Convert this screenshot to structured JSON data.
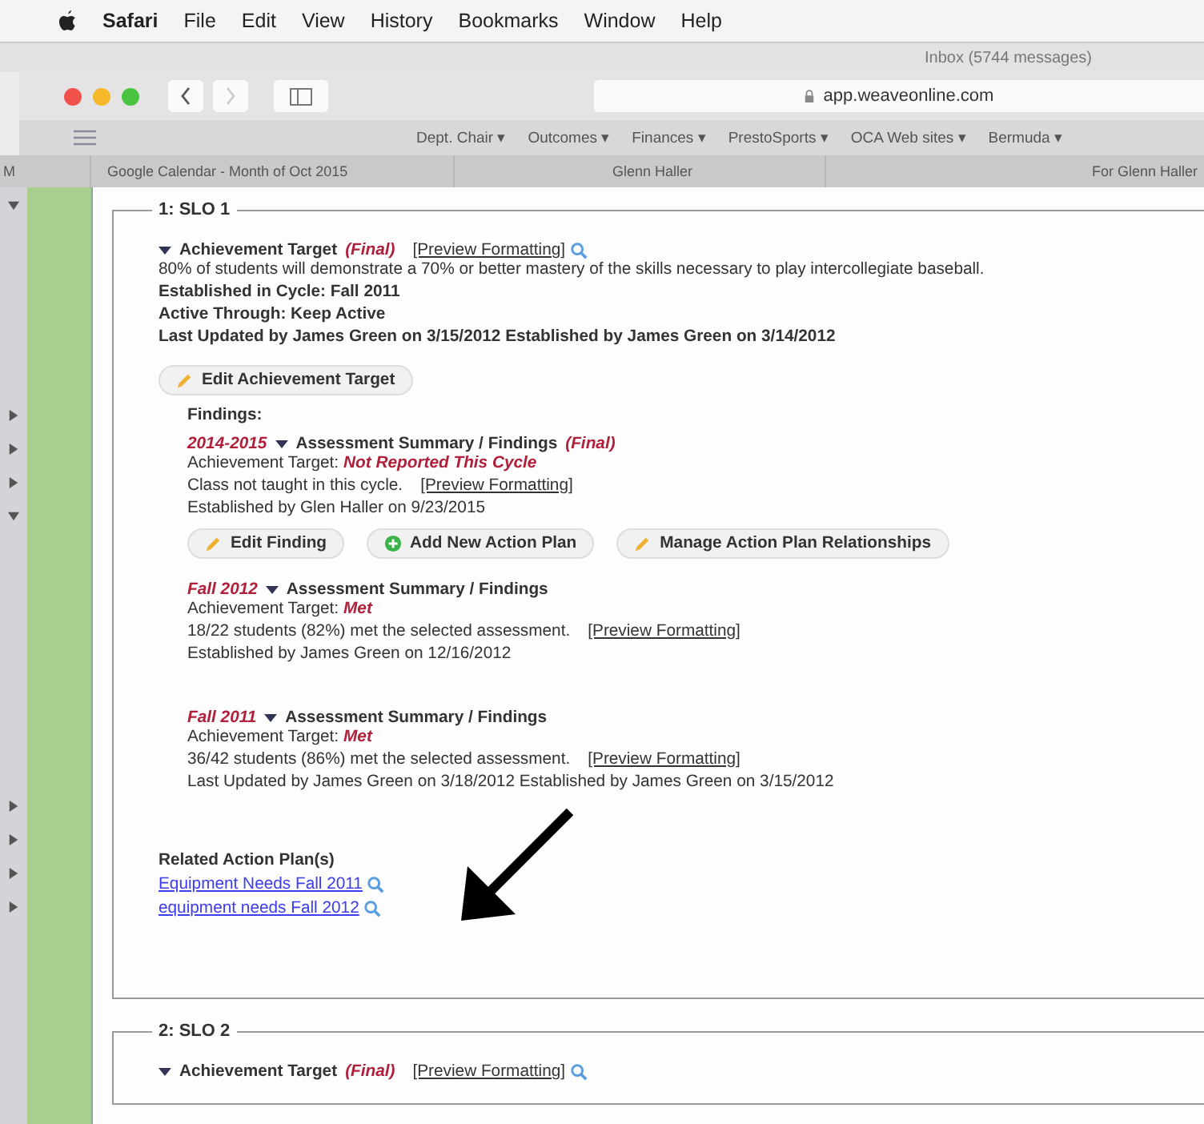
{
  "menu_bar": {
    "app": "Safari",
    "items": [
      "File",
      "Edit",
      "View",
      "History",
      "Bookmarks",
      "Window",
      "Help"
    ]
  },
  "background_window": {
    "title": "Inbox (5744 messages)"
  },
  "toolbar": {
    "address": "app.weaveonline.com"
  },
  "bookmarks": [
    "Dept. Chair ▾",
    "Outcomes ▾",
    "Finances ▾",
    "PrestoSports ▾",
    "OCA Web sites ▾",
    "Bermuda ▾"
  ],
  "tabs": [
    {
      "label": "Google Calendar - Month of Oct 2015",
      "selected": false
    },
    {
      "label": "Glenn Haller",
      "selected": false
    },
    {
      "label": "For Glenn Haller",
      "selected": false
    }
  ],
  "sidebar": {
    "label": "M",
    "toggles": [
      {
        "expanded": true
      },
      {
        "expanded": false
      },
      {
        "expanded": false
      },
      {
        "expanded": false
      },
      {
        "expanded": true
      },
      {
        "expanded": false
      },
      {
        "expanded": false
      },
      {
        "expanded": false
      },
      {
        "expanded": false
      }
    ]
  },
  "sections": [
    {
      "legend": "1: SLO 1",
      "target": {
        "title": "Achievement Target",
        "status": "(Final)",
        "preview": "[Preview Formatting]",
        "text": "80% of students will demonstrate a 70% or better mastery of the skills necessary to play intercollegiate baseball.",
        "details": [
          "Established in Cycle: Fall 2011",
          "Active Through: Keep Active",
          "Last Updated by James Green on 3/15/2012 Established by James Green on 3/14/2012"
        ],
        "button": "Edit Achievement Target"
      },
      "findings_label": "Findings:",
      "findings": [
        {
          "period": "2014-2015",
          "title": "Assessment Summary / Findings",
          "status": "(Final)",
          "target_label": "Achievement Target:",
          "target_value": "Not Reported This Cycle",
          "description": "Class not taught in this cycle.",
          "preview": "[Preview Formatting]",
          "established": "Established by Glen Haller on 9/23/2015",
          "buttons": [
            {
              "kind": "edit",
              "label": "Edit Finding"
            },
            {
              "kind": "add",
              "label": "Add New Action Plan"
            },
            {
              "kind": "edit",
              "label": "Manage Action Plan Relationships"
            }
          ]
        },
        {
          "period": "Fall 2012",
          "title": "Assessment Summary / Findings",
          "target_label": "Achievement Target:",
          "target_value": "Met",
          "description": "18/22 students (82%) met the selected assessment.",
          "preview": "[Preview Formatting]",
          "established": "Established by James Green on 12/16/2012"
        },
        {
          "period": "Fall 2011",
          "title": "Assessment Summary / Findings",
          "target_label": "Achievement Target:",
          "target_value": "Met",
          "description": "36/42 students (86%) met the selected assessment.",
          "preview": "[Preview Formatting]",
          "established": "Last Updated by James Green on 3/18/2012 Established by James Green on 3/15/2012"
        }
      ],
      "related_label": "Related Action Plan(s)",
      "related": [
        {
          "label": "Equipment Needs  Fall 2011"
        },
        {
          "label": "equipment needs  Fall 2012"
        }
      ]
    },
    {
      "legend": "2: SLO 2",
      "target": {
        "title": "Achievement Target",
        "status": "(Final)",
        "preview": "[Preview Formatting]"
      }
    }
  ]
}
